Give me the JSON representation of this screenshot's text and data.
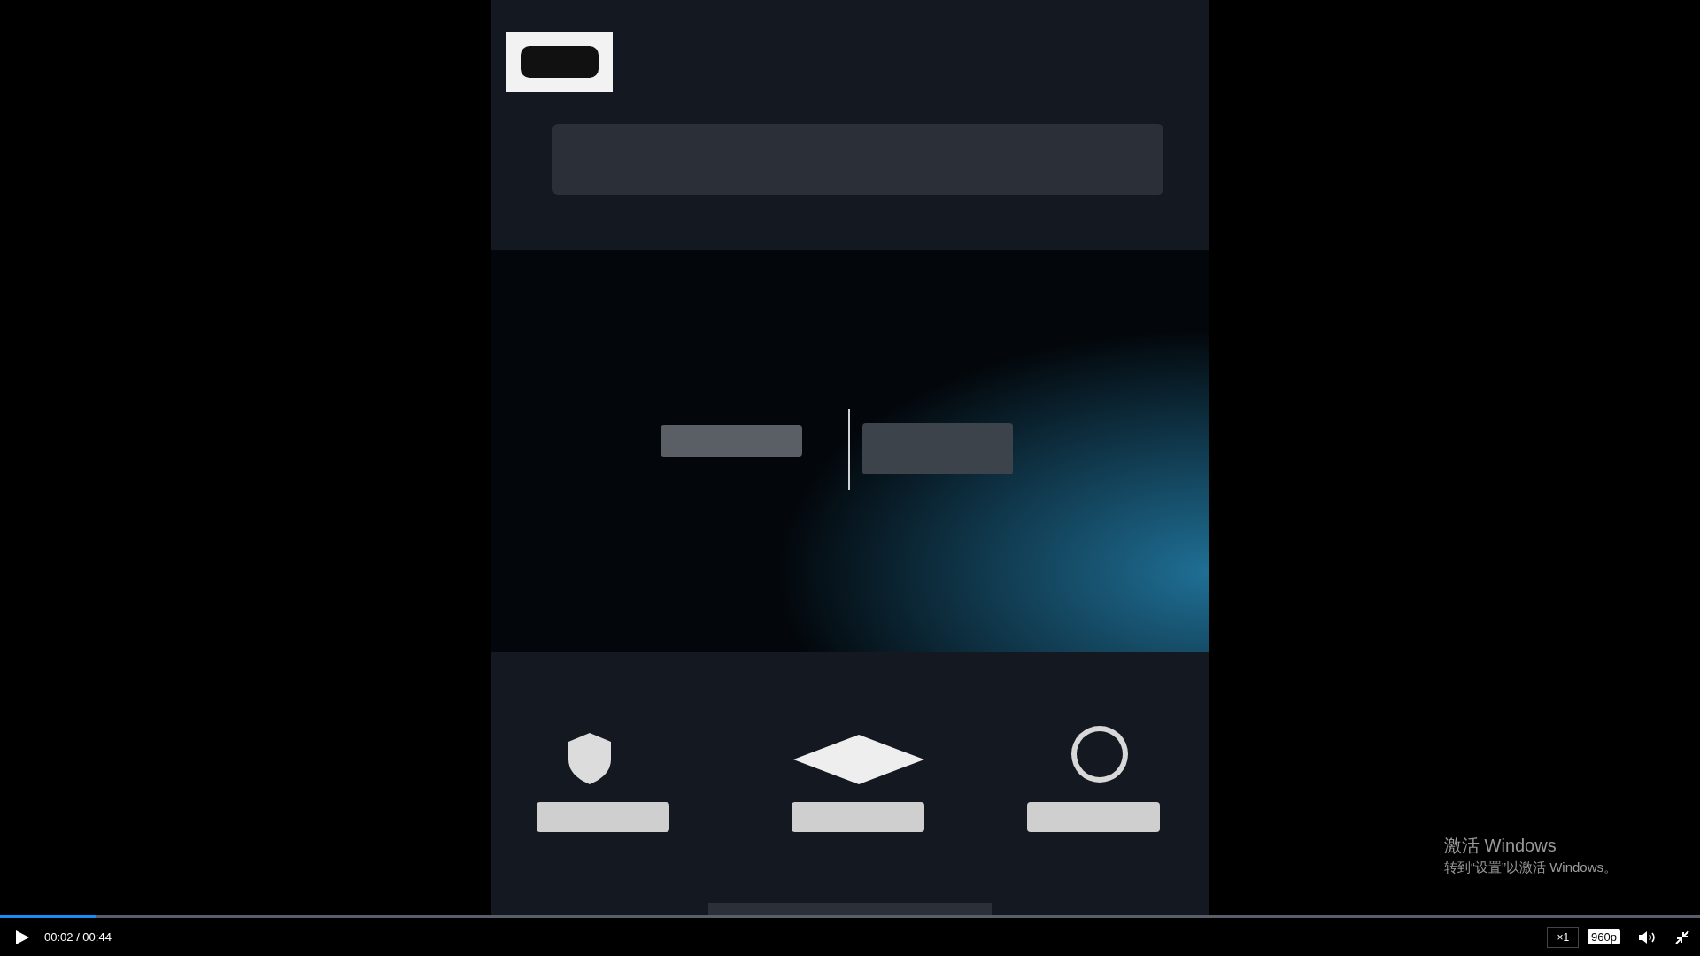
{
  "player": {
    "progress": {
      "level": 0.056
    },
    "playing": false,
    "time": "00:02 / 00:44",
    "speed": "×1",
    "quality": "960p",
    "muted": false
  },
  "os_notice": {
    "title": "激活 Windows",
    "text": "转到“设置”以激活 Windows。"
  }
}
